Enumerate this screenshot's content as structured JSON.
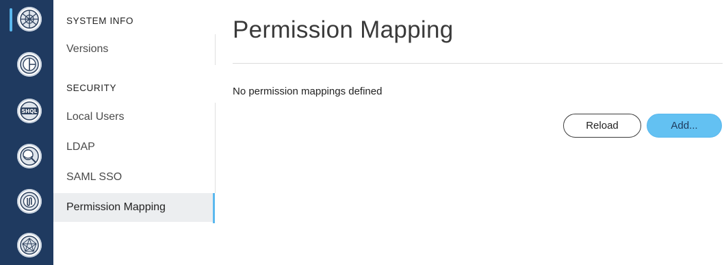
{
  "rail": {
    "icons": [
      {
        "name": "network-globe-icon",
        "active": true
      },
      {
        "name": "pie-chart-icon"
      },
      {
        "name": "shql-icon",
        "label": "SHQL"
      },
      {
        "name": "globe-search-icon"
      },
      {
        "name": "switch-icon"
      },
      {
        "name": "network-topology-icon"
      }
    ],
    "accent": "#5ab8ee",
    "background": "#1f3a60"
  },
  "sidebar": {
    "section_system_info": "SYSTEM INFO",
    "versions": "Versions",
    "section_security": "SECURITY",
    "local_users": "Local Users",
    "ldap": "LDAP",
    "saml_sso": "SAML SSO",
    "permission_mapping": "Permission Mapping"
  },
  "main": {
    "title": "Permission Mapping",
    "empty_message": "No permission mappings defined",
    "reload_label": "Reload",
    "add_label": "Add..."
  }
}
